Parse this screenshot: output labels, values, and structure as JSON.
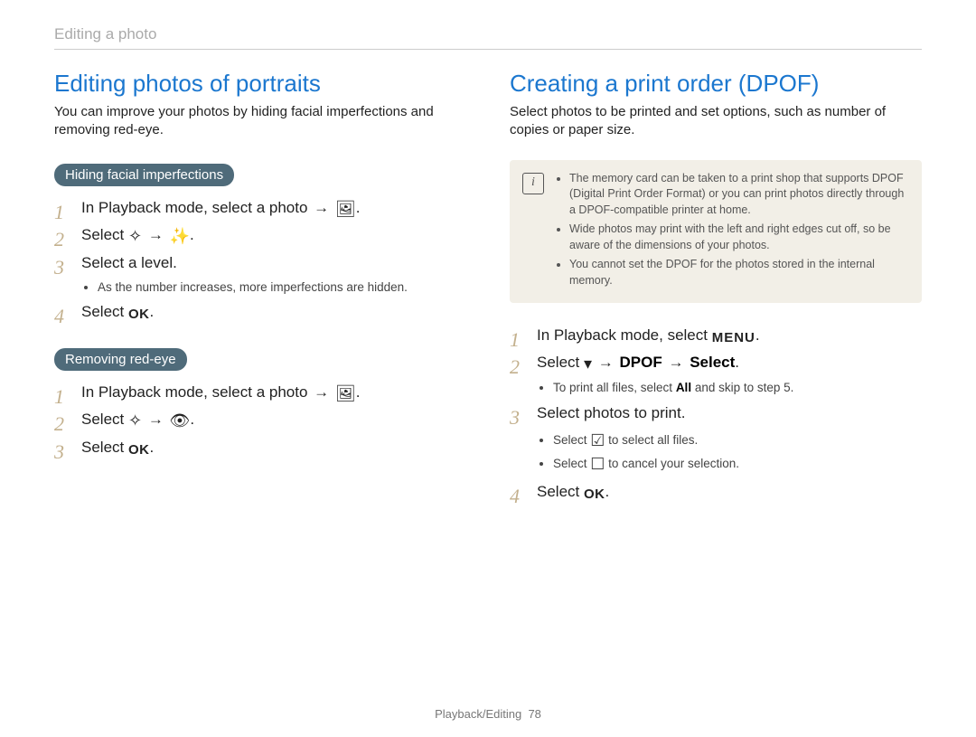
{
  "breadcrumb": "Editing a photo",
  "left": {
    "title": "Editing photos of portraits",
    "intro": "You can improve your photos by hiding facial imperfections and removing red-eye.",
    "section1": {
      "pill": "Hiding facial imperfections",
      "steps": {
        "s1a": "In Playback mode, select a photo ",
        "s2a": "Select ",
        "s3a": "Select a level.",
        "s3_note": "As the number increases, more imperfections are hidden.",
        "s4a": "Select "
      }
    },
    "section2": {
      "pill": "Removing red-eye",
      "steps": {
        "s1a": "In Playback mode, select a photo ",
        "s2a": "Select ",
        "s3a": "Select "
      }
    }
  },
  "right": {
    "title": "Creating a print order (DPOF)",
    "intro": "Select photos to be printed and set options, such as number of copies or paper size.",
    "notes": {
      "n1": "The memory card can be taken to a print shop that supports DPOF (Digital Print Order Format) or you can print photos directly through a DPOF-compatible printer at home.",
      "n2": "Wide photos may print with the left and right edges cut off, so be aware of the dimensions of your photos.",
      "n3": "You cannot set the DPOF for the photos stored in the internal memory."
    },
    "steps": {
      "s1a": "In Playback mode, select ",
      "s2a": "Select ",
      "s2b": "DPOF",
      "s2c": "Select",
      "s2_note_a": "To print all files, select ",
      "s2_note_b": "All",
      "s2_note_c": " and skip to step 5.",
      "s3a": "Select photos to print.",
      "s3_note1a": "Select ",
      "s3_note1b": " to select all files.",
      "s3_note2a": "Select ",
      "s3_note2b": " to cancel your selection.",
      "s4a": "Select "
    }
  },
  "footer_section": "Playback/Editing",
  "footer_page": "78",
  "icons": {
    "arrow": "→",
    "edit_photo": "🖼",
    "face_retouch": "✧",
    "beauty": "✨",
    "red_eye": "👁",
    "down": "▾",
    "select_all": "☑",
    "deselect": "☐"
  }
}
